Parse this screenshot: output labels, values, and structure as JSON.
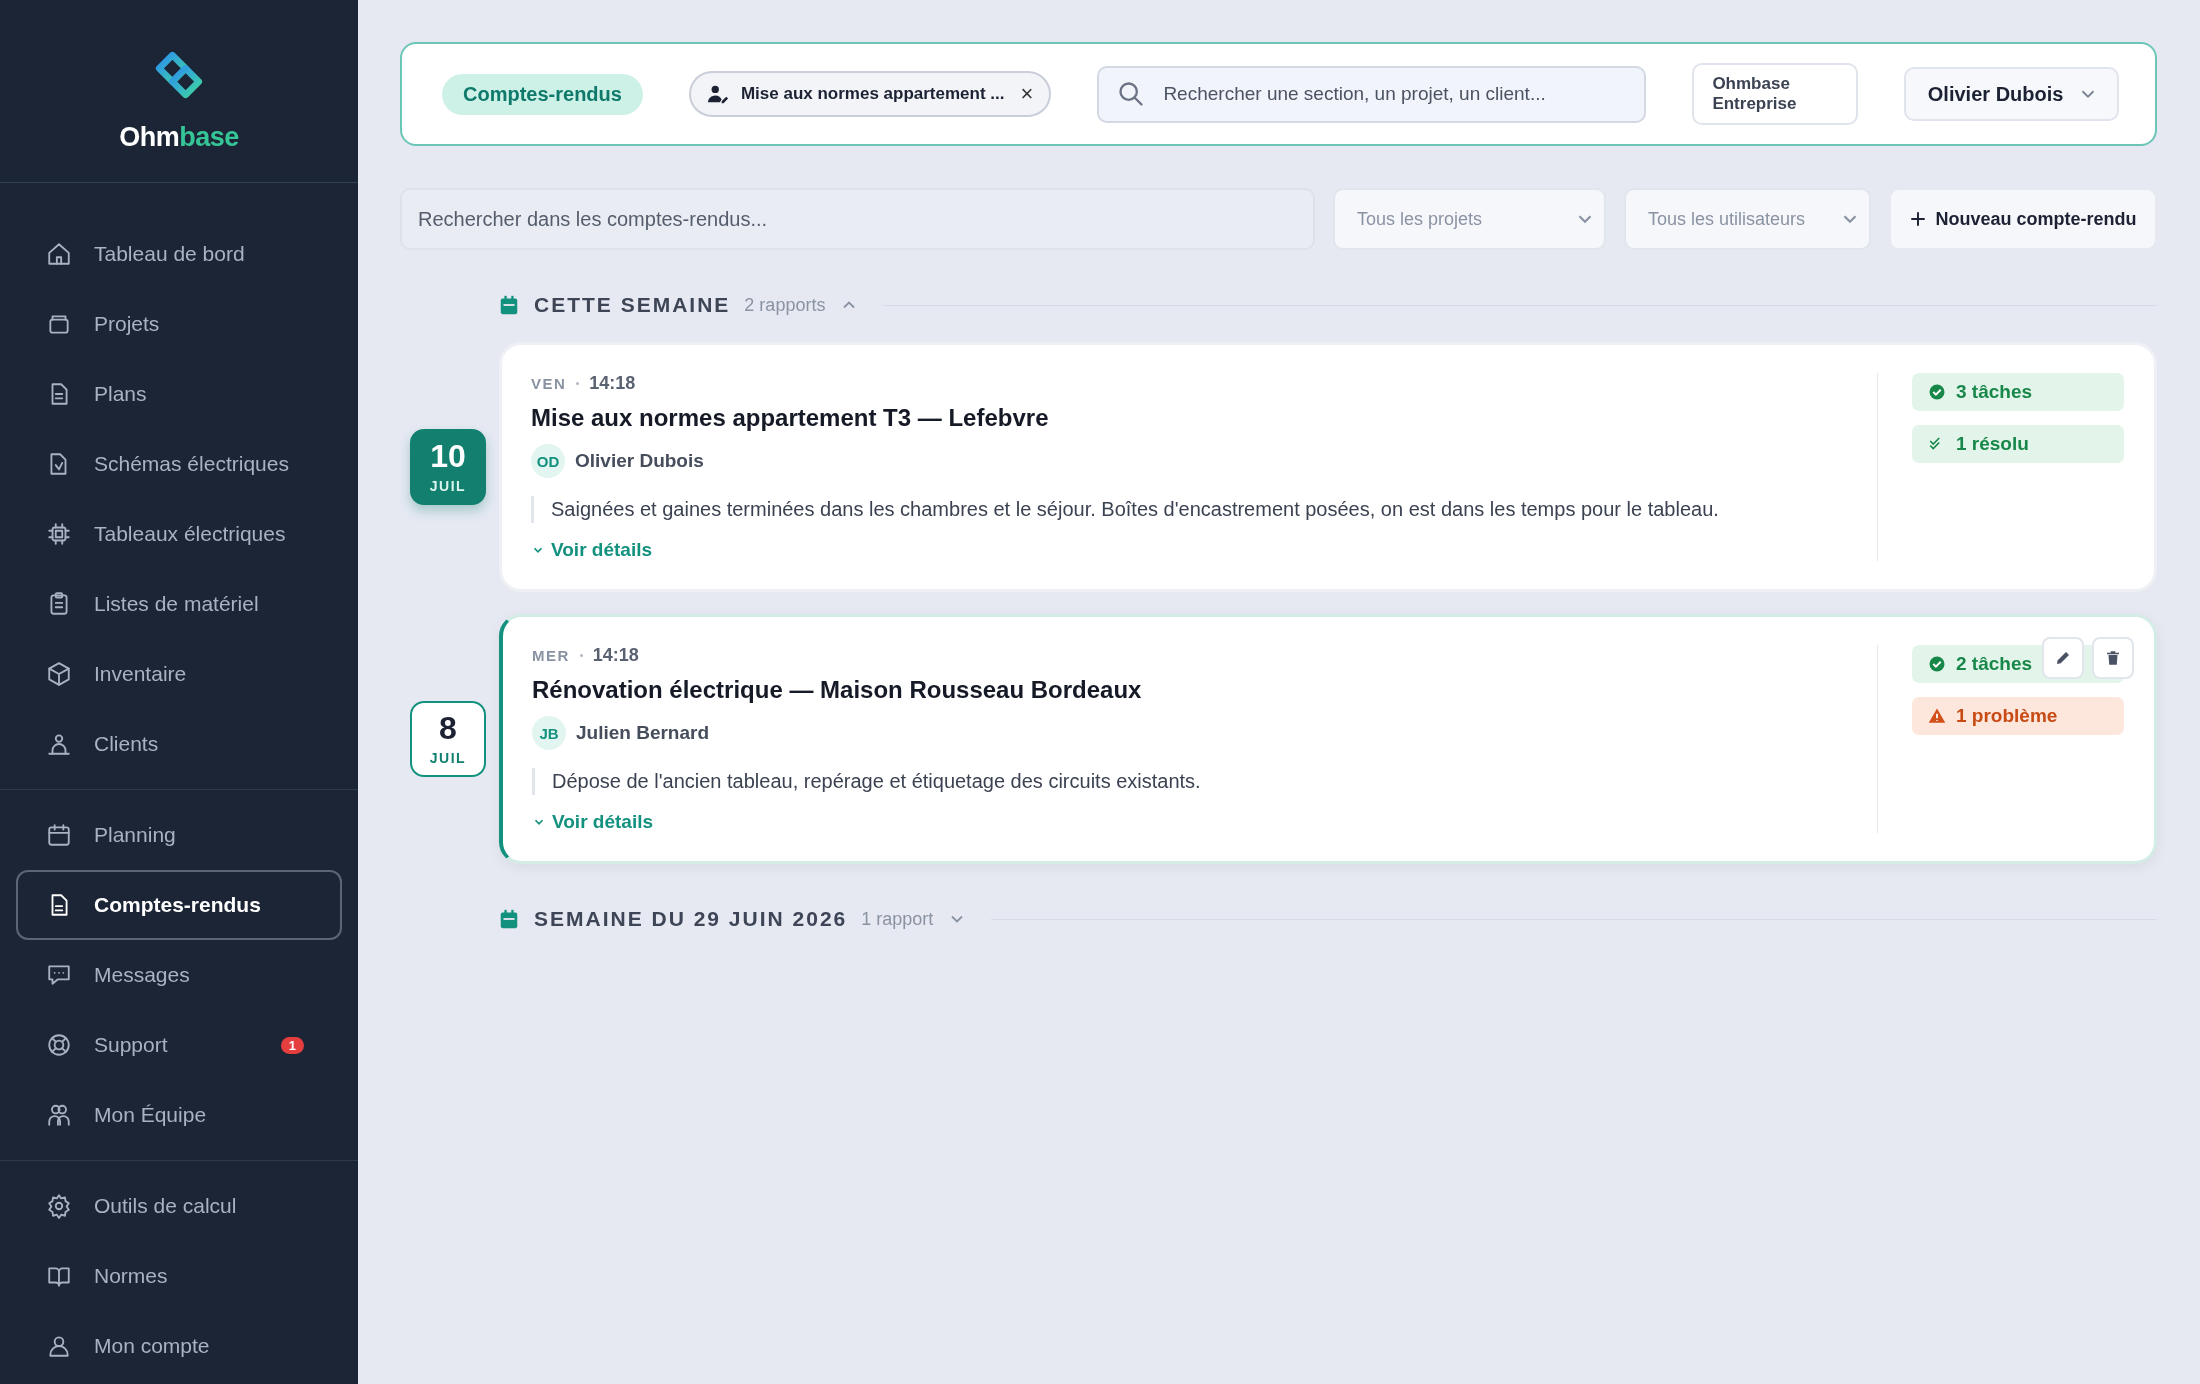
{
  "brand": {
    "prefix": "Ohm",
    "suffix": "base"
  },
  "sidebar": {
    "groups": [
      {
        "items": [
          {
            "label": "Tableau de bord",
            "selected": false
          },
          {
            "label": "Projets",
            "selected": false
          },
          {
            "label": "Plans",
            "selected": false
          },
          {
            "label": "Schémas électriques",
            "selected": false
          },
          {
            "label": "Tableaux électriques",
            "selected": false
          },
          {
            "label": "Listes de matériel",
            "selected": false
          },
          {
            "label": "Inventaire",
            "selected": false
          },
          {
            "label": "Clients",
            "selected": false
          }
        ]
      },
      {
        "items": [
          {
            "label": "Planning",
            "selected": false
          },
          {
            "label": "Comptes-rendus",
            "selected": true
          },
          {
            "label": "Messages",
            "selected": false
          },
          {
            "label": "Support",
            "selected": false,
            "badge": "1"
          },
          {
            "label": "Mon Équipe",
            "selected": false
          }
        ]
      },
      {
        "items": [
          {
            "label": "Outils de calcul",
            "selected": false
          },
          {
            "label": "Normes",
            "selected": false
          },
          {
            "label": "Mon compte",
            "selected": false
          }
        ]
      }
    ]
  },
  "header": {
    "section_chip": "Comptes-rendus",
    "project_chip": {
      "label": "Mise aux normes appartement ...",
      "close": "×"
    },
    "search": {
      "placeholder": "Rechercher une section, un projet, un client..."
    },
    "company": "Ohmbase Entreprise",
    "user": "Olivier Dubois"
  },
  "filters": {
    "search": {
      "placeholder": "Rechercher dans les comptes-rendus..."
    },
    "project_select": "Tous les projets",
    "user_select": "Tous les utilisateurs",
    "new_button": "Nouveau compte-rendu"
  },
  "weeks": [
    {
      "title": "CETTE SEMAINE",
      "count": "2 rapports",
      "expanded": true,
      "reports": [
        {
          "day": "10",
          "month": "JUIL",
          "weekday": "VEN",
          "time": "14:18",
          "latest": true,
          "selected": false,
          "title": "Mise aux normes appartement T3 — Lefebvre",
          "initials": "OD",
          "author": "Olivier Dubois",
          "summary": "Saignées et gaines terminées dans les chambres et le séjour. Boîtes d'encastrement posées, on est dans les temps pour le tableau.",
          "details_link": "Voir détails",
          "badges": [
            {
              "kind": "tasks",
              "label": "3 tâches"
            },
            {
              "kind": "resolved",
              "label": "1 résolu"
            }
          ]
        },
        {
          "day": "8",
          "month": "JUIL",
          "weekday": "MER",
          "time": "14:18",
          "latest": false,
          "selected": true,
          "title": "Rénovation électrique — Maison Rousseau Bordeaux",
          "initials": "JB",
          "author": "Julien Bernard",
          "summary": "Dépose de l'ancien tableau, repérage et étiquetage des circuits existants.",
          "details_link": "Voir détails",
          "badges": [
            {
              "kind": "tasks",
              "label": "2 tâches"
            },
            {
              "kind": "problem",
              "label": "1 problème"
            }
          ]
        }
      ]
    },
    {
      "title": "SEMAINE DU 29 JUIN 2026",
      "count": "1 rapport",
      "expanded": false
    }
  ]
}
